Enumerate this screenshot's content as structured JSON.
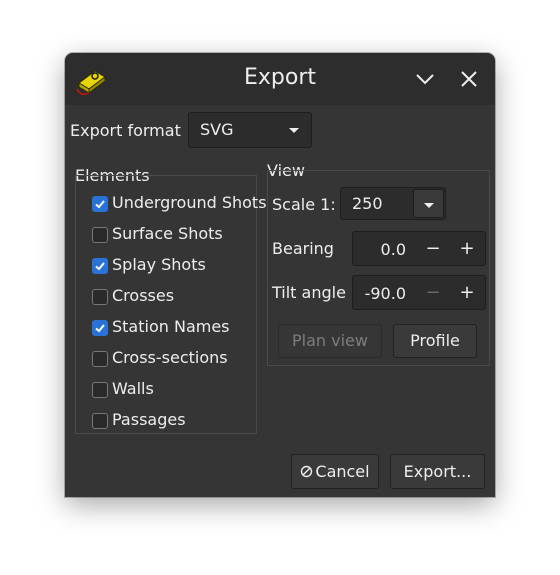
{
  "window": {
    "title": "Export",
    "minimize_icon": "chevron-down-icon",
    "close_icon": "close-icon",
    "app_icon": "cave-survey-app-icon"
  },
  "export_format": {
    "label": "Export format",
    "selected": "SVG"
  },
  "elements": {
    "title": "Elements",
    "items": [
      {
        "label": "Underground Shots",
        "checked": true
      },
      {
        "label": "Surface Shots",
        "checked": false
      },
      {
        "label": "Splay Shots",
        "checked": true
      },
      {
        "label": "Crosses",
        "checked": false
      },
      {
        "label": "Station Names",
        "checked": true
      },
      {
        "label": "Cross-sections",
        "checked": false
      },
      {
        "label": "Walls",
        "checked": false
      },
      {
        "label": "Passages",
        "checked": false
      }
    ]
  },
  "view": {
    "title": "View",
    "scale_label": "Scale 1:",
    "scale_value": "250",
    "bearing_label": "Bearing",
    "bearing_value": "0.0",
    "tilt_label": "Tilt angle",
    "tilt_value": "-90.0",
    "minus": "−",
    "plus": "+",
    "plan_view_label": "Plan view",
    "profile_label": "Profile"
  },
  "buttons": {
    "cancel_label": "Cancel",
    "cancel_icon": "cancel-icon",
    "export_label": "Export..."
  },
  "colors": {
    "accent": "#2a73d6",
    "window_bg": "#353535",
    "titlebar_bg": "#2d2d2d"
  }
}
